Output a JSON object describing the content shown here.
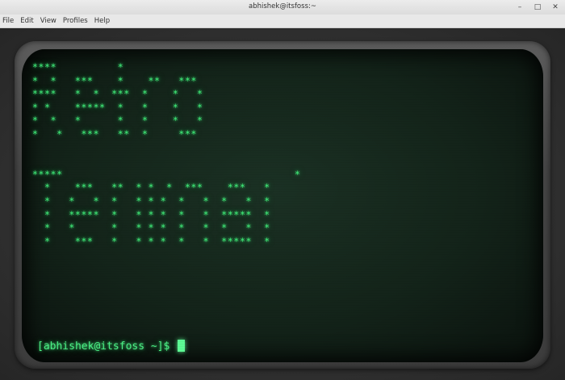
{
  "window": {
    "title": "abhishek@itsfoss:~",
    "controls": {
      "minimize": "–",
      "maximize": "□",
      "close": "✕"
    }
  },
  "menubar": {
    "items": [
      "File",
      "Edit",
      "View",
      "Profiles",
      "Help"
    ]
  },
  "terminal": {
    "ascii_art": "****          *\n*  *   ***    *    **   ***\n****   *  *  ***  *    *   *\n* *    *****  *   *    *   *\n*  *   *      *   *    *   *\n*   *   ***   **  *     ***\n\n\n*****                                      *\n  *    ***   **  * *  *  ***    ***   *\n  *   *   *  *   * * *  *   *  *   *  *\n  *   *****  *   * * *  *   *  *****  *\n  *   *      *   * * *  *   *  *   *  *\n  *    ***   *   * * *  *   *  *****  *",
    "prompt": "[abhishek@itsfoss ~]$ "
  },
  "colors": {
    "phosphor": "#40f07a",
    "screen_bg": "#132319"
  }
}
